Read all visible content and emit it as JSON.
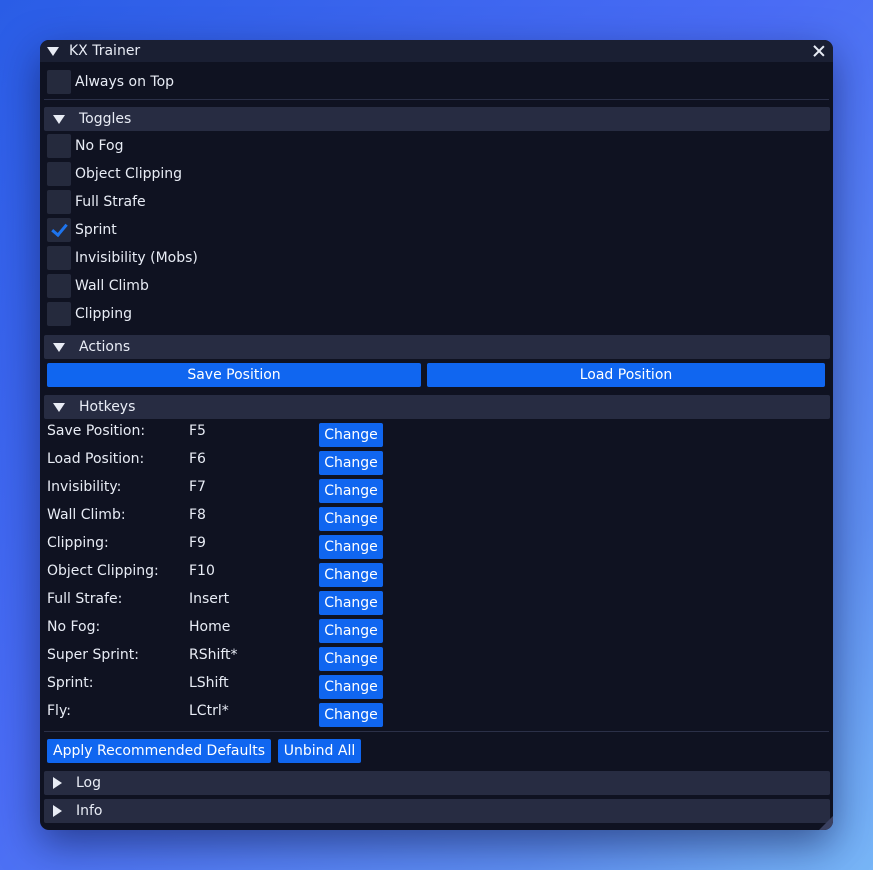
{
  "window": {
    "title": "KX Trainer"
  },
  "always_on_top": {
    "label": "Always on Top",
    "checked": false
  },
  "sections": {
    "toggles": "Toggles",
    "actions": "Actions",
    "hotkeys": "Hotkeys",
    "log": "Log",
    "info": "Info"
  },
  "toggles": [
    {
      "label": "No Fog",
      "checked": false
    },
    {
      "label": "Object Clipping",
      "checked": false
    },
    {
      "label": "Full Strafe",
      "checked": false
    },
    {
      "label": "Sprint",
      "checked": true
    },
    {
      "label": "Invisibility (Mobs)",
      "checked": false
    },
    {
      "label": "Wall Climb",
      "checked": false
    },
    {
      "label": "Clipping",
      "checked": false
    }
  ],
  "actions": {
    "save": "Save Position",
    "load": "Load Position"
  },
  "hotkeys": [
    {
      "label": "Save Position:",
      "key": "F5",
      "button": "Change"
    },
    {
      "label": "Load Position:",
      "key": "F6",
      "button": "Change"
    },
    {
      "label": "Invisibility:",
      "key": "F7",
      "button": "Change"
    },
    {
      "label": "Wall Climb:",
      "key": "F8",
      "button": "Change"
    },
    {
      "label": "Clipping:",
      "key": "F9",
      "button": "Change"
    },
    {
      "label": "Object Clipping:",
      "key": "F10",
      "button": "Change"
    },
    {
      "label": "Full Strafe:",
      "key": "Insert",
      "button": "Change"
    },
    {
      "label": "No Fog:",
      "key": "Home",
      "button": "Change"
    },
    {
      "label": "Super Sprint:",
      "key": "RShift*",
      "button": "Change"
    },
    {
      "label": "Sprint:",
      "key": "LShift",
      "button": "Change"
    },
    {
      "label": "Fly:",
      "key": "LCtrl*",
      "button": "Change"
    }
  ],
  "hotkey_actions": {
    "defaults": "Apply Recommended Defaults",
    "unbind": "Unbind All"
  },
  "colors": {
    "accent": "#1066f0",
    "background": "#0f1221",
    "header": "#272c42"
  }
}
